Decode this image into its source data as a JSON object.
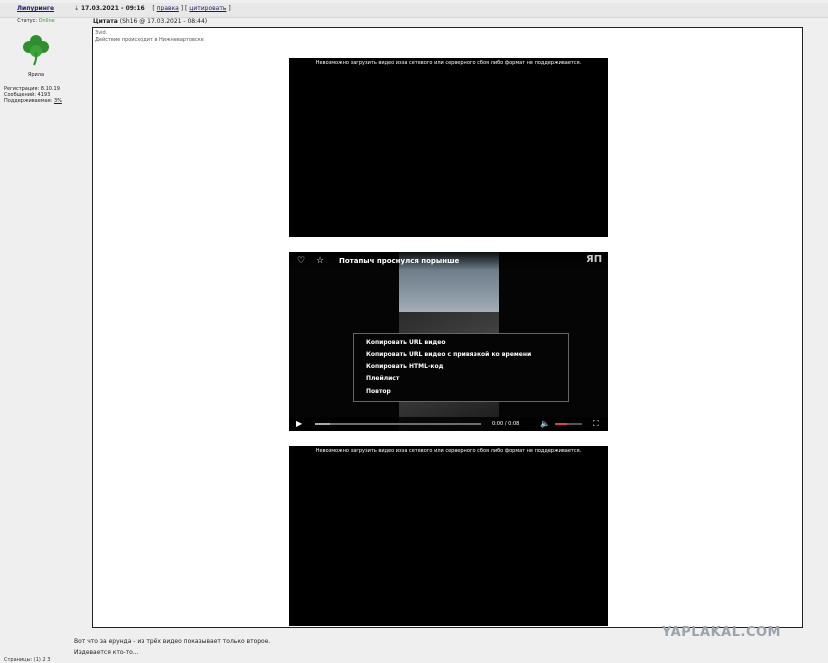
{
  "post": {
    "username": "Липуринге",
    "date": "17.03.2021 - 09:16",
    "bracket_open": "[",
    "link_rate": "правка",
    "bracket_mid": "] [",
    "link_quote": "цитировать",
    "bracket_close": "]"
  },
  "sidebar": {
    "status_label": "Статус:",
    "status_value": "Online",
    "karma": "Ярила",
    "registered": "Регистрация: 8.10.19",
    "messages": "Сообщений: 4193",
    "reputation_label": "Поддерживаемая:",
    "reputation_value": "3%"
  },
  "quote": {
    "header_label": "Цитата",
    "header_meta": "(Sh16 @ 17.03.2021 - 08:44)",
    "line1": "Зvid.",
    "line2": "Действие происходит в Нижневартовске",
    "video_error": "Невозможно загрузить видео изза сетевого или серверного сбоя либо формат не поддерживается."
  },
  "player": {
    "title": "Потапыч проснулся порынше",
    "logo": "ЯП",
    "menu": [
      "Копировать URL видео",
      "Копировать URL видео с привязкой ко времени",
      "Копировать HTML-код",
      "Плейлист",
      "Повтор"
    ],
    "time": "0:00  /  0:08",
    "progress_fraction": 0.09,
    "volume_fraction": 0.45
  },
  "reply": {
    "line1": "Вот что за ерунда - из трёх видео показывает только второе.",
    "line2": "Издевается кто-то..."
  },
  "watermark": "YAPLAKAL.COM",
  "pager": "Страницы: (1) 2 3"
}
